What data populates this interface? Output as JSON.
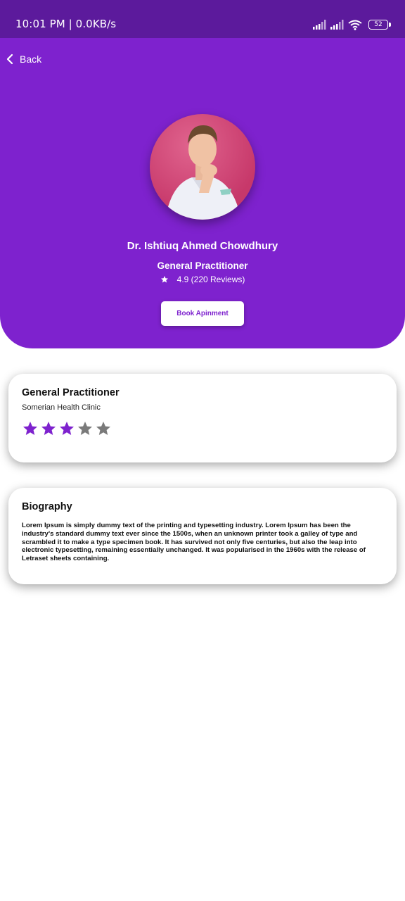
{
  "status_bar": {
    "time": "10:01 PM | 0.0KB/s",
    "battery": "52"
  },
  "nav": {
    "back_label": "Back"
  },
  "profile": {
    "name": "Dr. Ishtiuq Ahmed Chowdhury",
    "role": "General Practitioner",
    "rating_text": "4.9 (220 Reviews)",
    "book_label": "Book Apinment"
  },
  "info_card": {
    "title": "General Practitioner",
    "clinic": "Somerian Health Clinic",
    "stars_filled": 3,
    "stars_total": 5
  },
  "bio_card": {
    "title": "Biography",
    "text": "Lorem Ipsum is simply dummy text of the printing and typesetting industry. Lorem Ipsum has been the industry's standard dummy text ever since the 1500s, when an unknown printer took a galley of type and scrambled it to make a type specimen book. It has survived not only five centuries, but also the leap into electronic typesetting, remaining essentially unchanged. It was popularised in the 1960s with the release of Letraset sheets containing."
  },
  "colors": {
    "status_bar": "#5c1a9c",
    "hero": "#7e22ce",
    "star_filled": "#7e22ce",
    "star_empty": "#7a7a7a"
  }
}
